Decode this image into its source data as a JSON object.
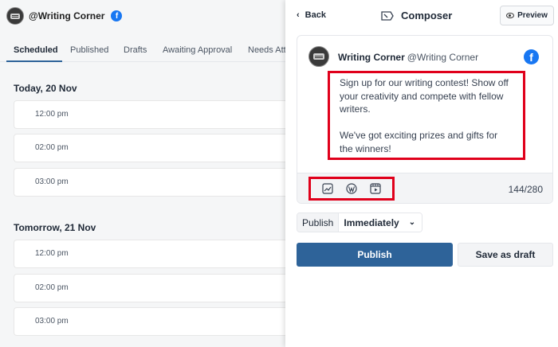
{
  "account": {
    "name": "@Writing Corner",
    "network_icon": "facebook-icon"
  },
  "tabs": [
    {
      "label": "Scheduled",
      "active": true
    },
    {
      "label": "Published"
    },
    {
      "label": "Drafts"
    },
    {
      "label": "Awaiting Approval"
    },
    {
      "label": "Needs Att"
    }
  ],
  "schedule": [
    {
      "day": "Today, 20 Nov",
      "slots": [
        "12:00 pm",
        "02:00 pm",
        "03:00 pm"
      ]
    },
    {
      "day": "Tomorrow, 21 Nov",
      "slots": [
        "12:00 pm",
        "02:00 pm",
        "03:00 pm"
      ]
    }
  ],
  "composer": {
    "back_label": "Back",
    "title": "Composer",
    "preview_label": "Preview",
    "author_name": "Writing Corner",
    "author_handle": "@Writing Corner",
    "post_text": "Sign up for our writing contest! Show off your creativity and compete with fellow writers.\n\nWe've got exciting prizes and gifts for the winners!",
    "char_count": "144/280",
    "toolbar_icons": [
      "image-chart-icon",
      "wordpress-icon",
      "media-library-icon"
    ],
    "publish_label": "Publish",
    "publish_when": "Immediately",
    "publish_button": "Publish",
    "draft_button": "Save as draft"
  },
  "colors": {
    "primary": "#2e6399",
    "highlight": "#e0001b",
    "facebook": "#1877f2"
  }
}
